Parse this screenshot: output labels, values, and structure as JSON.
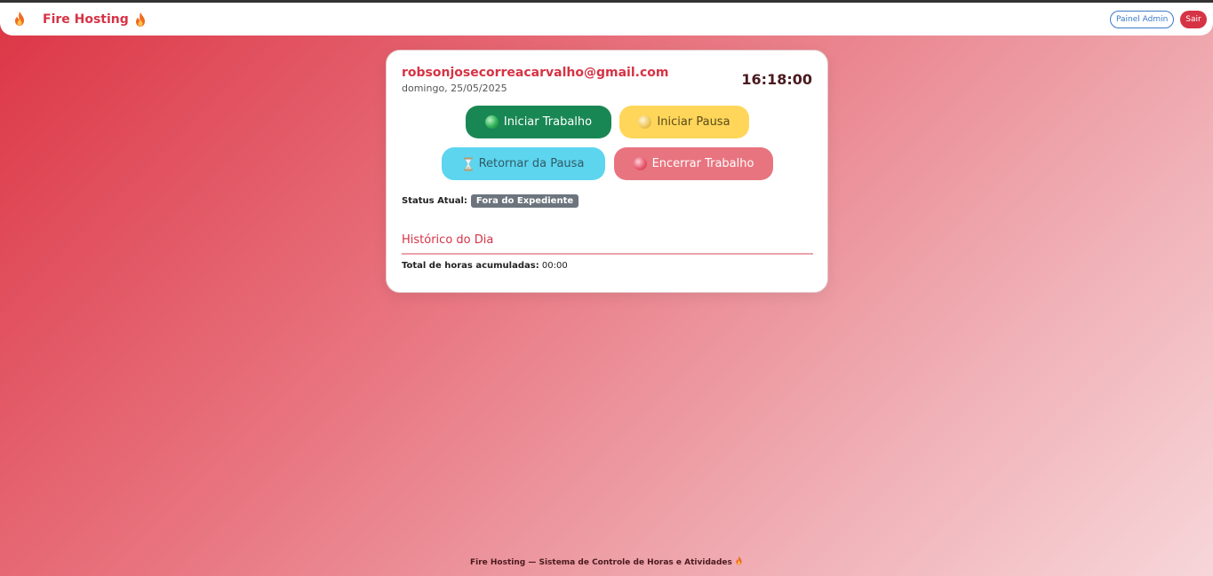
{
  "navbar": {
    "brand": "Fire Hosting",
    "admin_label": "Painel Admin",
    "logout_label": "Sair"
  },
  "card": {
    "email": "robsonjosecorreacarvalho@gmail.com",
    "date": "domingo, 25/05/2025",
    "clock": "16:18:00",
    "buttons": {
      "start_work": "Iniciar Trabalho",
      "start_pause": "Iniciar Pausa",
      "return_pause": "Retornar da Pausa",
      "end_work": "Encerrar Trabalho"
    },
    "status_label": "Status Atual:",
    "status_value": "Fora do Expediente",
    "history_title": "Histórico do Dia",
    "total_label": "Total de horas acumuladas:",
    "total_value": "00:00"
  },
  "footer": {
    "text": "Fire Hosting — Sistema de Controle de Horas e Atividades"
  },
  "colors": {
    "accent": "#d63345",
    "success": "#198754",
    "warning": "#ffd65a",
    "info": "#5dd5ef",
    "danger_soft": "#e8747f",
    "badge": "#6c757d"
  },
  "icons": {
    "brand": "flame-icon",
    "start_work": "green-circle-icon",
    "start_pause": "yellow-circle-icon",
    "return_pause": "hourglass-icon",
    "end_work": "red-circle-icon"
  }
}
